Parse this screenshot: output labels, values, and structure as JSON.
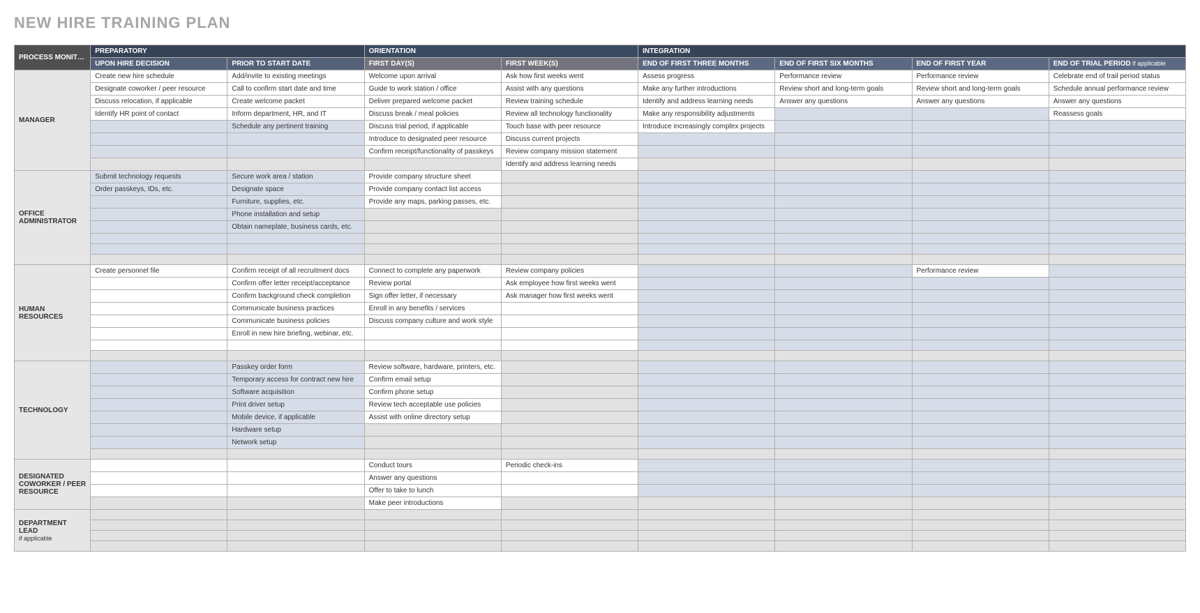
{
  "title": "NEW HIRE TRAINING PLAN",
  "gutter_header": "PROCESS MONITOR / MENTOR",
  "phase_headers": [
    "PREPARATORY",
    "ORIENTATION",
    "INTEGRATION"
  ],
  "col_headers": [
    "UPON HIRE DECISION",
    "PRIOR TO START DATE",
    "FIRST DAY(S)",
    "FIRST WEEK(S)",
    "END OF FIRST THREE MONTHS",
    "END OF FIRST SIX MONTHS",
    "END OF FIRST YEAR",
    "END OF TRIAL PERIOD"
  ],
  "trial_note": " if applicable",
  "sections": [
    {
      "name": "MANAGER",
      "row_count": 8,
      "shade": [
        "w",
        "w",
        "w",
        "w",
        "b",
        "b",
        "b",
        "g"
      ],
      "cols": [
        [
          "Create new hire schedule",
          "Designate coworker / peer resource",
          "Discuss relocation, if applicable",
          "Identify HR point of contact",
          "",
          "",
          "",
          ""
        ],
        [
          "Add/invite to existing meetings",
          "Call to confirm start date and time",
          "Create welcome packet",
          "Inform department, HR, and IT",
          "Schedule any pertinent training",
          "",
          "",
          ""
        ],
        [
          "Welcome upon arrival",
          "Guide to work station / office",
          "Deliver prepared welcome packet",
          "Discuss break / meal policies",
          "Discuss trial period, if applicable",
          "Introduce to designated peer resource",
          "Confirm receipt/functionality of passkeys",
          ""
        ],
        [
          "Ask how first weeks went",
          "Assist with any questions",
          "Review training schedule",
          "Review all technology functionality",
          "Touch base with peer resource",
          "Discuss current projects",
          "Review company mission statement",
          "Identify and address learning needs"
        ],
        [
          "Assess progress",
          "Make any further introductions",
          "Identify and address learning needs",
          "Make any responsibility adjustments",
          "Introduce increasingly complex projects",
          "",
          "",
          ""
        ],
        [
          "Performance review",
          "Review short and long-term goals",
          "Answer any questions",
          "",
          "",
          "",
          "",
          ""
        ],
        [
          "Performance review",
          "Review short and long-term goals",
          "Answer any questions",
          "",
          "",
          "",
          "",
          ""
        ],
        [
          "Celebrate end of trail period status",
          "Schedule annual performance review",
          "Answer any questions",
          "Reassess goals",
          "",
          "",
          "",
          ""
        ]
      ]
    },
    {
      "name": "OFFICE ADMINISTRATOR",
      "row_count": 8,
      "shade": [
        "b",
        "b",
        "b",
        "b",
        "b",
        "b",
        "b",
        "g"
      ],
      "cols": [
        [
          "Submit technology requests",
          "Order passkeys, IDs, etc.",
          "",
          "",
          "",
          "",
          "",
          ""
        ],
        [
          "Secure work area / station",
          "Designate space",
          "Furniture, supplies, etc.",
          "Phone installation and setup",
          "Obtain nameplate, business cards, etc.",
          "",
          "",
          ""
        ],
        [
          "Provide company structure sheet",
          "Provide company contact list access",
          "Provide any maps, parking passes, etc.",
          "",
          "",
          "",
          "",
          ""
        ],
        [
          "",
          "",
          "",
          "",
          "",
          "",
          "",
          ""
        ],
        [
          "",
          "",
          "",
          "",
          "",
          "",
          "",
          ""
        ],
        [
          "",
          "",
          "",
          "",
          "",
          "",
          "",
          ""
        ],
        [
          "",
          "",
          "",
          "",
          "",
          "",
          "",
          ""
        ],
        [
          "",
          "",
          "",
          "",
          "",
          "",
          "",
          ""
        ]
      ]
    },
    {
      "name": "HUMAN RESOURCES",
      "row_count": 8,
      "shade": [
        "w",
        "w",
        "w",
        "w",
        "w",
        "w",
        "w",
        "g"
      ],
      "cols": [
        [
          "Create personnel file",
          "",
          "",
          "",
          "",
          "",
          "",
          ""
        ],
        [
          "Confirm receipt of all recruitment docs",
          "Confirm offer letter receipt/acceptance",
          "Confirm background check completion",
          "Communicate business practices",
          "Communicate business policies",
          "Enroll in new hire briefing, webinar, etc.",
          "",
          ""
        ],
        [
          "Connect to complete any paperwork",
          "Review portal",
          "Sign offer letter, if necessary",
          "Enroll in any benefits / services",
          "Discuss company culture and work style",
          "",
          "",
          ""
        ],
        [
          "Review company policies",
          "Ask employee how first weeks went",
          "Ask manager how first weeks went",
          "",
          "",
          "",
          "",
          ""
        ],
        [
          "",
          "",
          "",
          "",
          "",
          "",
          "",
          ""
        ],
        [
          "",
          "",
          "",
          "",
          "",
          "",
          "",
          ""
        ],
        [
          "Performance review",
          "",
          "",
          "",
          "",
          "",
          "",
          ""
        ],
        [
          "",
          "",
          "",
          "",
          "",
          "",
          "",
          ""
        ]
      ]
    },
    {
      "name": "TECHNOLOGY",
      "row_count": 8,
      "shade": [
        "b",
        "b",
        "b",
        "b",
        "b",
        "b",
        "b",
        "g"
      ],
      "cols": [
        [
          "",
          "",
          "",
          "",
          "",
          "",
          "",
          ""
        ],
        [
          "Passkey order form",
          "Temporary access for contract new hire",
          "Software acquisition",
          "Print driver setup",
          "Mobile device, if applicable",
          "Hardware setup",
          "Network setup",
          ""
        ],
        [
          "Review software, hardware, printers, etc.",
          "Confirm email setup",
          "Confirm phone setup",
          "Review tech acceptable use policies",
          "Assist with online directory setup",
          "",
          "",
          ""
        ],
        [
          "",
          "",
          "",
          "",
          "",
          "",
          "",
          ""
        ],
        [
          "",
          "",
          "",
          "",
          "",
          "",
          "",
          ""
        ],
        [
          "",
          "",
          "",
          "",
          "",
          "",
          "",
          ""
        ],
        [
          "",
          "",
          "",
          "",
          "",
          "",
          "",
          ""
        ],
        [
          "",
          "",
          "",
          "",
          "",
          "",
          "",
          ""
        ]
      ]
    },
    {
      "name": "DESIGNATED COWORKER / PEER RESOURCE",
      "row_count": 4,
      "shade": [
        "w",
        "w",
        "w",
        "g"
      ],
      "cols": [
        [
          "",
          "",
          "",
          ""
        ],
        [
          "",
          "",
          "",
          ""
        ],
        [
          "Conduct tours",
          "Answer any questions",
          "Offer to take to lunch",
          "Make peer introductions"
        ],
        [
          "Periodic check-ins",
          "",
          "",
          ""
        ],
        [
          "",
          "",
          "",
          ""
        ],
        [
          "",
          "",
          "",
          ""
        ],
        [
          "",
          "",
          "",
          ""
        ],
        [
          "",
          "",
          "",
          ""
        ]
      ]
    },
    {
      "name": "DEPARTMENT LEAD",
      "name_note": "if applicable",
      "row_count": 4,
      "shade": [
        "g",
        "g",
        "g",
        "g"
      ],
      "cols": [
        [
          "",
          "",
          "",
          ""
        ],
        [
          "",
          "",
          "",
          ""
        ],
        [
          "",
          "",
          "",
          ""
        ],
        [
          "",
          "",
          "",
          ""
        ],
        [
          "",
          "",
          "",
          ""
        ],
        [
          "",
          "",
          "",
          ""
        ],
        [
          "",
          "",
          "",
          ""
        ],
        [
          "",
          "",
          "",
          ""
        ]
      ]
    }
  ]
}
